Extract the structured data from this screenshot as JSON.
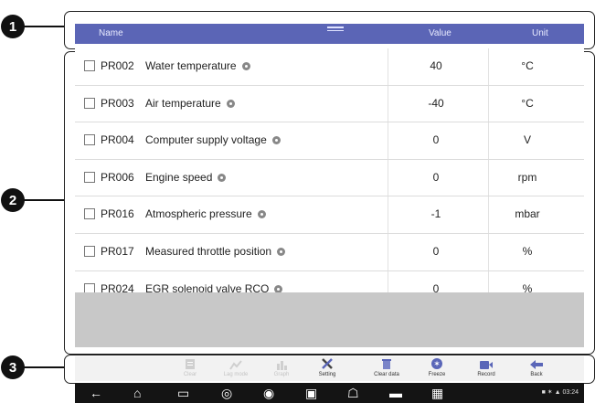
{
  "callouts": [
    "1",
    "2",
    "3"
  ],
  "header": {
    "name": "Name",
    "value": "Value",
    "unit": "Unit"
  },
  "rows": [
    {
      "id": "PR002",
      "name": "Water temperature",
      "value": "40",
      "unit": "°C"
    },
    {
      "id": "PR003",
      "name": "Air temperature",
      "value": "-40",
      "unit": "°C"
    },
    {
      "id": "PR004",
      "name": "Computer supply voltage",
      "value": "0",
      "unit": "V"
    },
    {
      "id": "PR006",
      "name": "Engine speed",
      "value": "0",
      "unit": "rpm"
    },
    {
      "id": "PR016",
      "name": "Atmospheric pressure",
      "value": "-1",
      "unit": "mbar"
    },
    {
      "id": "PR017",
      "name": "Measured throttle position",
      "value": "0",
      "unit": "%"
    },
    {
      "id": "PR024",
      "name": "EGR solenoid valve RCO",
      "value": "0",
      "unit": "%"
    }
  ],
  "toolbar": {
    "buttons": [
      {
        "label": "Clear",
        "enabled": false,
        "icon": "document-icon"
      },
      {
        "label": "Lag mode",
        "enabled": false,
        "icon": "graph-icon"
      },
      {
        "label": "Graph",
        "enabled": false,
        "icon": "bar-icon"
      },
      {
        "label": "Setting",
        "enabled": true,
        "icon": "wrench-icon"
      },
      {
        "label": "Clear data",
        "enabled": true,
        "icon": "trash-icon"
      },
      {
        "label": "Freeze",
        "enabled": true,
        "icon": "snowflake-icon"
      },
      {
        "label": "Record",
        "enabled": true,
        "icon": "record-icon"
      },
      {
        "label": "Back",
        "enabled": true,
        "icon": "back-arrow-icon"
      }
    ]
  },
  "status_bar": {
    "time": "03:24"
  },
  "colors": {
    "header": "#5b65b6",
    "toolbar_icon": "#5a66b8",
    "navbar": "#141414"
  }
}
